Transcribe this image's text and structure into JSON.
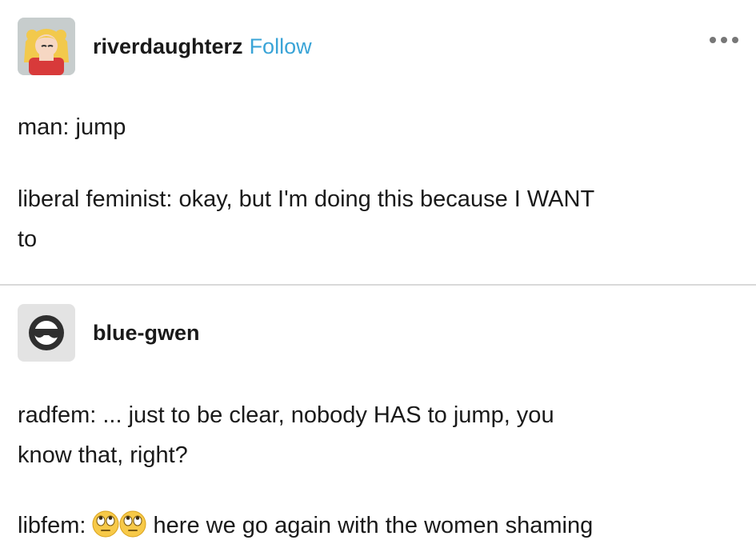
{
  "post": {
    "username": "riverdaughterz",
    "follow_label": "Follow",
    "avatar_icon": "anime-avatar-icon",
    "more_icon": "more-options-icon",
    "lines": [
      "man: jump",
      "liberal feminist: okay, but I'm doing this because I WANT",
      "to"
    ]
  },
  "reply": {
    "username": "blue-gwen",
    "avatar_icon": "sunglasses-face-icon",
    "lines": [
      "radfem: ... just to be clear, nobody HAS to jump, you",
      "know that, right?"
    ],
    "last_prefix": "libfem:",
    "last_icons": [
      "eye-roll-emoji-icon",
      "eye-roll-emoji-icon"
    ],
    "last_suffix": " here we go again with the women shaming"
  },
  "colors": {
    "accent": "#3aa4d7",
    "text": "#1a1a1a",
    "divider": "#d9d9d9"
  }
}
